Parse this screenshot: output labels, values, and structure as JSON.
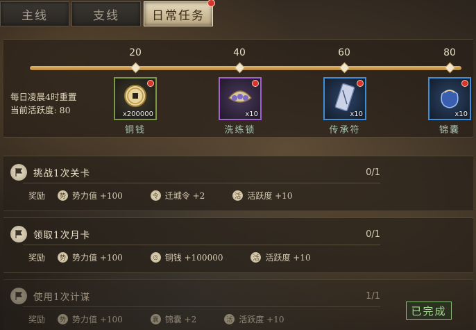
{
  "tabs": [
    {
      "label": "主线",
      "active": false
    },
    {
      "label": "支线",
      "active": false
    },
    {
      "label": "日常任务",
      "active": true
    }
  ],
  "progress": {
    "milestones": [
      "20",
      "40",
      "60",
      "80"
    ],
    "current_activity_value": 80
  },
  "info": {
    "reset_text": "每日凌晨4时重置",
    "activity_text": "当前活跃度: 80"
  },
  "rewards": [
    {
      "name": "铜钱",
      "qty": "x200000",
      "rarity": "green",
      "icon": "copper-coin-icon"
    },
    {
      "name": "洗练锁",
      "qty": "x10",
      "rarity": "purple",
      "icon": "refine-lock-icon"
    },
    {
      "name": "传承符",
      "qty": "x10",
      "rarity": "blue",
      "icon": "inheritance-talisman-icon"
    },
    {
      "name": "锦囊",
      "qty": "x10",
      "rarity": "blue",
      "icon": "brocade-pouch-icon"
    }
  ],
  "tasks": [
    {
      "title": "挑战1次关卡",
      "progress": "0/1",
      "reward_label": "奖励",
      "rewards": [
        {
          "icon": "power-icon",
          "text": "势力值 +100"
        },
        {
          "icon": "migration-order-icon",
          "text": "迁城令 +2"
        },
        {
          "icon": "activity-icon",
          "text": "活跃度 +10"
        }
      ]
    },
    {
      "title": "领取1次月卡",
      "progress": "0/1",
      "reward_label": "奖励",
      "rewards": [
        {
          "icon": "power-icon",
          "text": "势力值 +100"
        },
        {
          "icon": "copper-coin-icon",
          "text": "铜钱 +100000"
        },
        {
          "icon": "activity-icon",
          "text": "活跃度 +10"
        }
      ]
    },
    {
      "title": "使用1次计谋",
      "progress": "1/1",
      "reward_label": "奖励",
      "rewards": [
        {
          "icon": "power-icon",
          "text": "势力值 +100"
        },
        {
          "icon": "brocade-pouch-icon",
          "text": "锦囊 +2"
        },
        {
          "icon": "activity-icon",
          "text": "活跃度 +10"
        }
      ],
      "status": "已完成"
    }
  ]
}
